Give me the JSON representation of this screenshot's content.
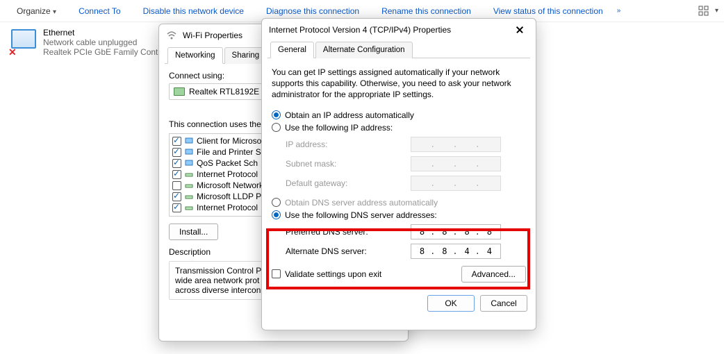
{
  "toolbar": {
    "organize": "Organize",
    "connect_to": "Connect To",
    "disable": "Disable this network device",
    "diagnose": "Diagnose this connection",
    "rename": "Rename this connection",
    "view_status": "View status of this connection",
    "more": "»"
  },
  "ethernet": {
    "title": "Ethernet",
    "status": "Network cable unplugged",
    "adapter": "Realtek PCIe GbE Family Contro..."
  },
  "wifi_dialog": {
    "title": "Wi-Fi Properties",
    "tabs": {
      "networking": "Networking",
      "sharing": "Sharing"
    },
    "connect_using": "Connect using:",
    "adapter_name": "Realtek RTL8192E",
    "components_label": "This connection uses the",
    "items": [
      {
        "checked": true,
        "icon": "client",
        "label": "Client for Microso"
      },
      {
        "checked": true,
        "icon": "share",
        "label": "File and Printer S"
      },
      {
        "checked": true,
        "icon": "qos",
        "label": "QoS Packet Sch"
      },
      {
        "checked": true,
        "icon": "proto",
        "label": "Internet Protocol"
      },
      {
        "checked": false,
        "icon": "net",
        "label": "Microsoft Network"
      },
      {
        "checked": true,
        "icon": "proto",
        "label": "Microsoft LLDP P"
      },
      {
        "checked": true,
        "icon": "proto",
        "label": "Internet Protocol"
      }
    ],
    "install_btn": "Install...",
    "description_heading": "Description",
    "description_text": "Transmission Control Pr\nwide area network prot\nacross diverse intercon"
  },
  "ipv4_dialog": {
    "title": "Internet Protocol Version 4 (TCP/IPv4) Properties",
    "tabs": {
      "general": "General",
      "alternate": "Alternate Configuration"
    },
    "intro": "You can get IP settings assigned automatically if your network supports this capability. Otherwise, you need to ask your network administrator for the appropriate IP settings.",
    "ip_auto": "Obtain an IP address automatically",
    "ip_manual": "Use the following IP address:",
    "ip_address_label": "IP address:",
    "subnet_label": "Subnet mask:",
    "gateway_label": "Default gateway:",
    "dns_auto": "Obtain DNS server address automatically",
    "dns_manual": "Use the following DNS server addresses:",
    "preferred_dns_label": "Preferred DNS server:",
    "alternate_dns_label": "Alternate DNS server:",
    "preferred_dns": [
      "8",
      "8",
      "8",
      "8"
    ],
    "alternate_dns": [
      "8",
      "8",
      "4",
      "4"
    ],
    "validate": "Validate settings upon exit",
    "advanced_btn": "Advanced...",
    "ok_btn": "OK",
    "cancel_btn": "Cancel"
  }
}
